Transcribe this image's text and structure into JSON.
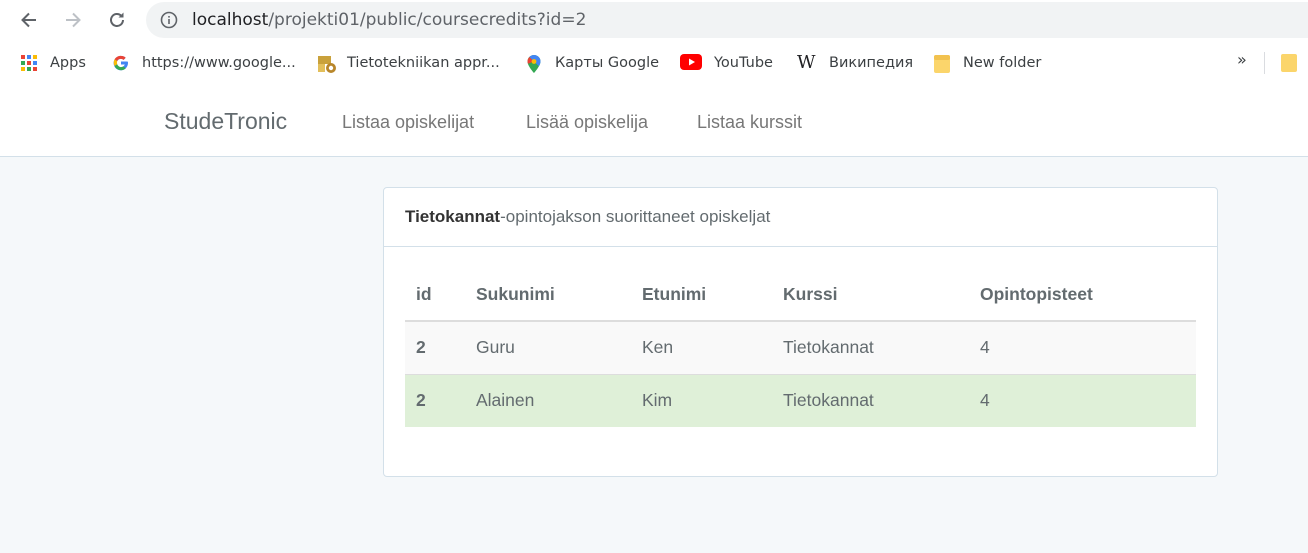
{
  "browser": {
    "url_host": "localhost",
    "url_path": "/projekti01/public/coursecredits?id=2",
    "bookmarks": [
      {
        "label": "Apps",
        "icon": "apps-grid-icon"
      },
      {
        "label": "https://www.google...",
        "icon": "google-icon"
      },
      {
        "label": "Tietotekniikan appr...",
        "icon": "bookmark-site-icon"
      },
      {
        "label": "Карты Google",
        "icon": "maps-pin-icon"
      },
      {
        "label": "YouTube",
        "icon": "youtube-icon"
      },
      {
        "label": "Википедия",
        "icon": "wikipedia-icon"
      },
      {
        "label": "New folder",
        "icon": "folder-icon"
      }
    ],
    "more_label": "»"
  },
  "navbar": {
    "brand": "StudeTronic",
    "links": [
      "Listaa opiskelijat",
      "Lisää opiskelija",
      "Listaa kurssit"
    ]
  },
  "panel": {
    "heading_bold": "Tietokannat",
    "heading_rest": "-opintojakson suorittaneet opiskeljat",
    "table": {
      "columns": [
        "id",
        "Sukunimi",
        "Etunimi",
        "Kurssi",
        "Opintopisteet"
      ],
      "rows": [
        [
          "2",
          "Guru",
          "Ken",
          "Tietokannat",
          "4"
        ],
        [
          "2",
          "Alainen",
          "Kim",
          "Tietokannat",
          "4"
        ]
      ]
    }
  },
  "colors": {
    "success_row": "#dff0d8",
    "striped_row": "#f9f9f9",
    "page_bg": "#f5f8fa",
    "youtube_red": "#ff0000"
  }
}
